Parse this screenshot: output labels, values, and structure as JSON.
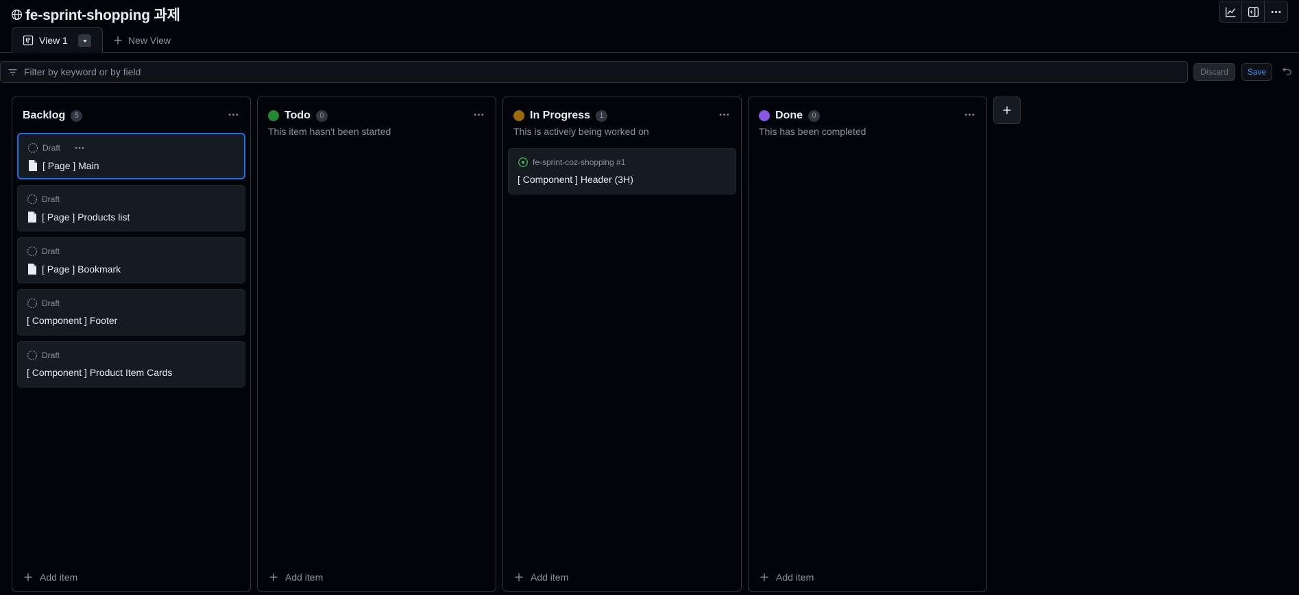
{
  "project": {
    "title": "fe-sprint-shopping 과제",
    "visibility_icon": "globe-icon"
  },
  "top_actions": [
    {
      "name": "insights-button",
      "icon": "graph-icon"
    },
    {
      "name": "side-panel-button",
      "icon": "sidebar-icon"
    },
    {
      "name": "more-options-button",
      "icon": "kebab-horizontal-icon"
    }
  ],
  "tabs": {
    "active_label": "View 1",
    "new_view_label": "New View"
  },
  "filter": {
    "placeholder": "Filter by keyword or by field",
    "discard_label": "Discard",
    "save_label": "Save"
  },
  "columns": [
    {
      "name": "Backlog",
      "count": "5",
      "color": "",
      "description": "",
      "cards": [
        {
          "status": "Draft",
          "title": "[ Page ] Main",
          "has_doc_icon": true,
          "selected": true
        },
        {
          "status": "Draft",
          "title": "[ Page ] Products list",
          "has_doc_icon": true,
          "selected": false
        },
        {
          "status": "Draft",
          "title": "[ Page ] Bookmark",
          "has_doc_icon": true,
          "selected": false
        },
        {
          "status": "Draft",
          "title": "[ Component ] Footer",
          "has_doc_icon": false,
          "selected": false
        },
        {
          "status": "Draft",
          "title": "[ Component ] Product Item Cards",
          "has_doc_icon": false,
          "selected": false
        }
      ],
      "add_label": "Add item"
    },
    {
      "name": "Todo",
      "count": "0",
      "color": "#238636",
      "description": "This item hasn't been started",
      "cards": [],
      "add_label": "Add item"
    },
    {
      "name": "In Progress",
      "count": "1",
      "color": "#9e6a03",
      "description": "This is actively being worked on",
      "cards": [
        {
          "status": "fe-sprint-coz-shopping #1",
          "title": "[ Component ] Header (3H)",
          "is_issue": true
        }
      ],
      "add_label": "Add item"
    },
    {
      "name": "Done",
      "count": "0",
      "color": "#8957e5",
      "description": "This has been completed",
      "cards": [],
      "add_label": "Add item"
    }
  ]
}
